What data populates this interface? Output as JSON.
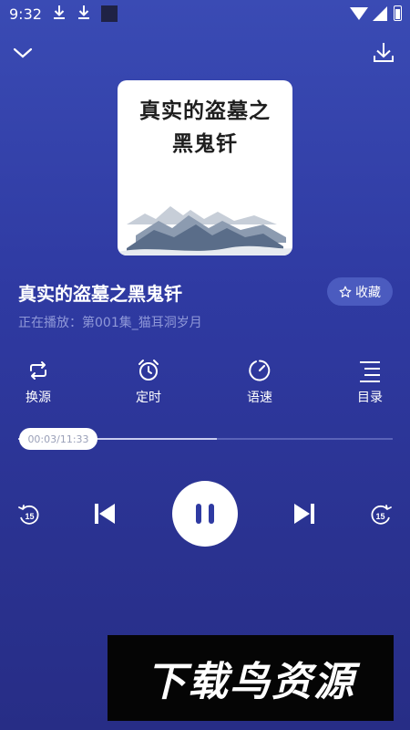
{
  "status_bar": {
    "time": "9:32"
  },
  "book": {
    "cover_title_line1": "真实的盗墓之",
    "cover_title_line2": "黑鬼钎",
    "title": "真实的盗墓之黑鬼钎",
    "now_playing": "正在播放：第001集_猫耳洞岁月"
  },
  "favorite": {
    "label": "收藏"
  },
  "controls": [
    {
      "label": "换源",
      "icon": "repeat-icon"
    },
    {
      "label": "定时",
      "icon": "alarm-clock-icon"
    },
    {
      "label": "语速",
      "icon": "speed-gauge-icon"
    },
    {
      "label": "目录",
      "icon": "list-icon"
    }
  ],
  "progress": {
    "time_text": "00:03/11:33",
    "current_fraction": 0.004,
    "buffered_fraction": 0.53
  },
  "player": {
    "rewind_label": "15",
    "forward_label": "15"
  },
  "watermark": {
    "text": "下载鸟资源"
  },
  "colors": {
    "background": "#2f3aa2",
    "accent": "#ffffff",
    "subtext": "#8f98d8"
  }
}
